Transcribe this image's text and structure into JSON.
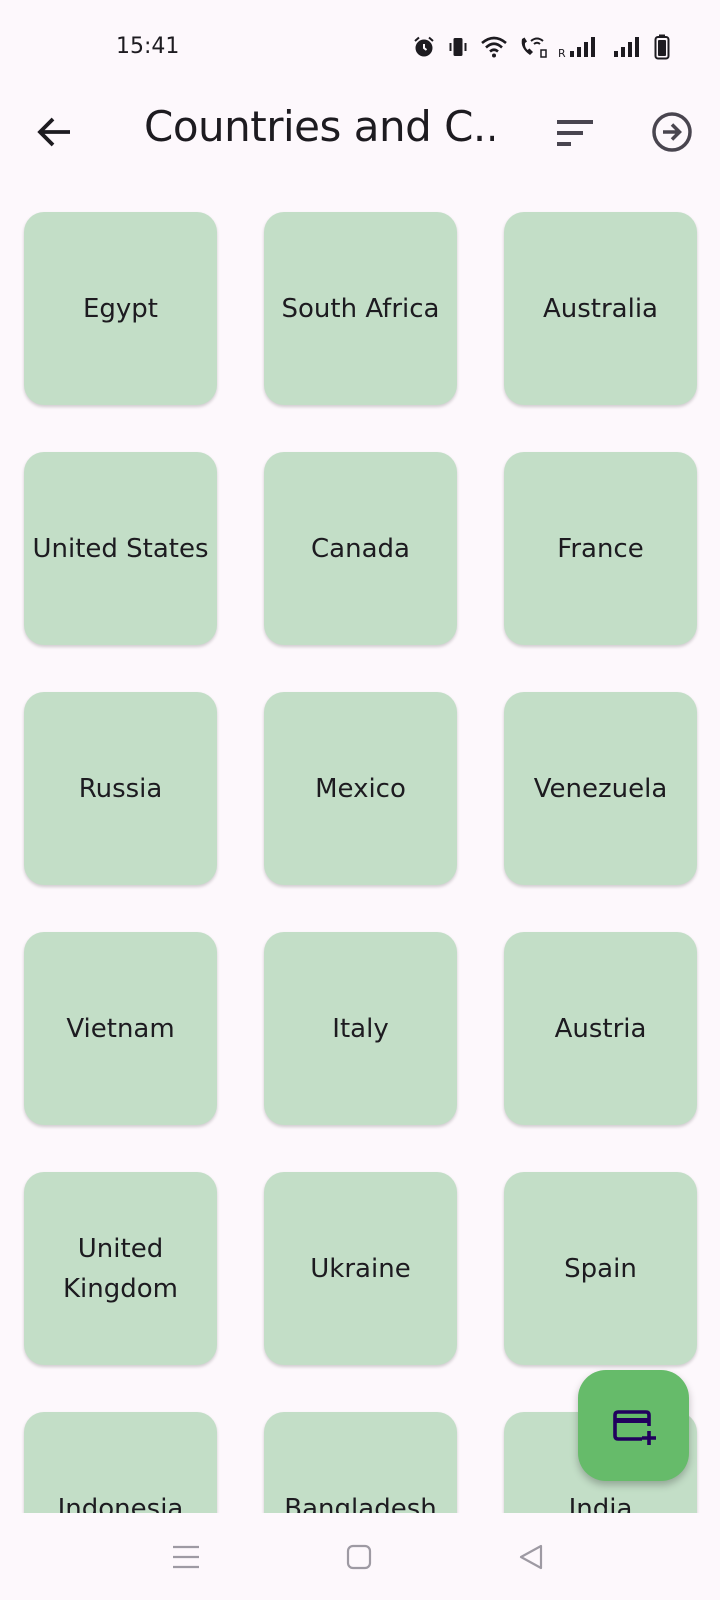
{
  "status_bar": {
    "time": "15:41",
    "icons": [
      "alarm-icon",
      "vibrate-icon",
      "wifi-icon",
      "wifi-calling-icon",
      "signal-roaming-icon",
      "signal-icon",
      "battery-icon"
    ]
  },
  "app_bar": {
    "title": "Countries and C...",
    "back_icon": "arrow-back-icon",
    "sort_icon": "sort-icon",
    "next_icon": "arrow-circle-right-icon"
  },
  "countries": [
    "Egypt",
    "South Africa",
    "Australia",
    "United States",
    "Canada",
    "France",
    "Russia",
    "Mexico",
    "Venezuela",
    "Vietnam",
    "Italy",
    "Austria",
    "United Kingdom",
    "Ukraine",
    "Spain",
    "Indonesia",
    "Bangladesh",
    "India"
  ],
  "fab": {
    "icon": "add-card-icon"
  },
  "nav_bar": {
    "icons": [
      "menu-icon",
      "home-square-icon",
      "back-triangle-icon"
    ]
  },
  "colors": {
    "background": "#fdf8fc",
    "tile": "#c3dec7",
    "fab": "#66bb6a",
    "fab_icon": "#21005d"
  }
}
